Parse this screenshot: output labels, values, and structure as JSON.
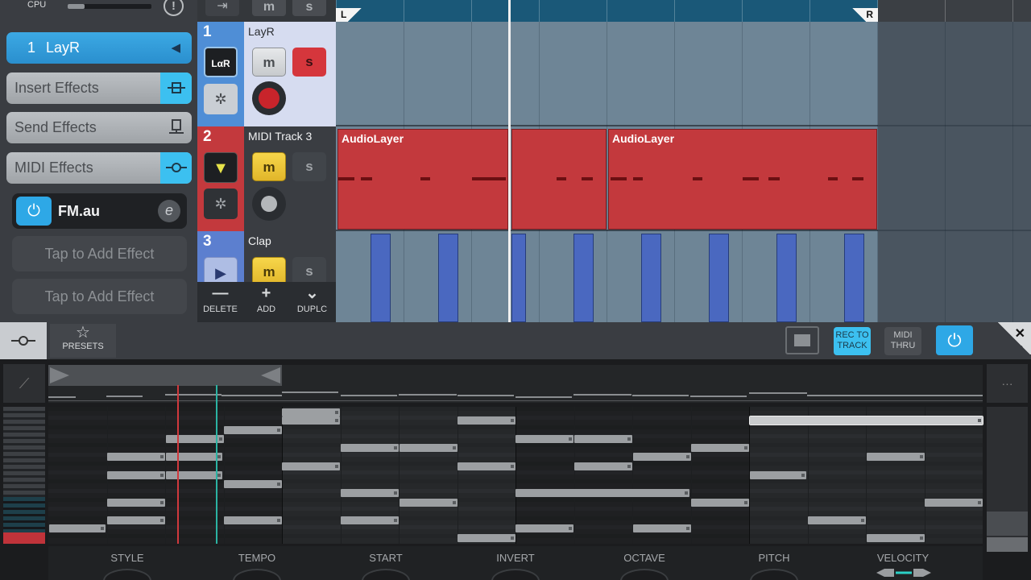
{
  "cpu": {
    "label": "CPU",
    "load_fraction": 0.2
  },
  "left_panel": {
    "track_selector": {
      "number": "1",
      "name": "LayR"
    },
    "insert_effects": "Insert Effects",
    "send_effects": "Send Effects",
    "midi_effects": "MIDI Effects",
    "plugin": {
      "name": "FM.au",
      "edit_glyph": "e"
    },
    "empty_slots": [
      "Tap to Add Effect",
      "Tap to Add Effect"
    ]
  },
  "tracks": [
    {
      "number": "1",
      "name": "LayR",
      "mute": "m",
      "solo": "s",
      "icon": "layr-logo-icon"
    },
    {
      "number": "2",
      "name": "MIDI Track 3",
      "mute": "m",
      "solo": "s",
      "icon": "midi-arrow-icon"
    },
    {
      "number": "3",
      "name": "Clap",
      "mute": "m",
      "solo": "s",
      "icon": "play-icon"
    }
  ],
  "track_actions": {
    "delete": "DELETE",
    "add": "ADD",
    "duplicate": "DUPLC"
  },
  "locators": {
    "left": "L",
    "right": "R"
  },
  "clips": [
    {
      "label": "AudioLayer"
    },
    {
      "label": "AudioLayer"
    }
  ],
  "editor_toolbar": {
    "presets": "PRESETS",
    "rec_to_track": [
      "REC TO",
      "TRACK"
    ],
    "midi_thru": [
      "MIDI",
      "THRU"
    ],
    "close": "✕",
    "more": "···"
  },
  "pattern_params": [
    "STYLE",
    "TEMPO",
    "START",
    "INVERT",
    "OCTAVE",
    "PITCH",
    "VELOCITY"
  ],
  "colors": {
    "accent_blue": "#2ea8e6",
    "track1": "#4f8ed6",
    "track2": "#c3393d",
    "track3": "#5c7fcf",
    "clip_red": "#c3393d",
    "clip_blue": "#4a68c0",
    "cue_red": "#d0393d",
    "cue_teal": "#2bb3a3"
  }
}
